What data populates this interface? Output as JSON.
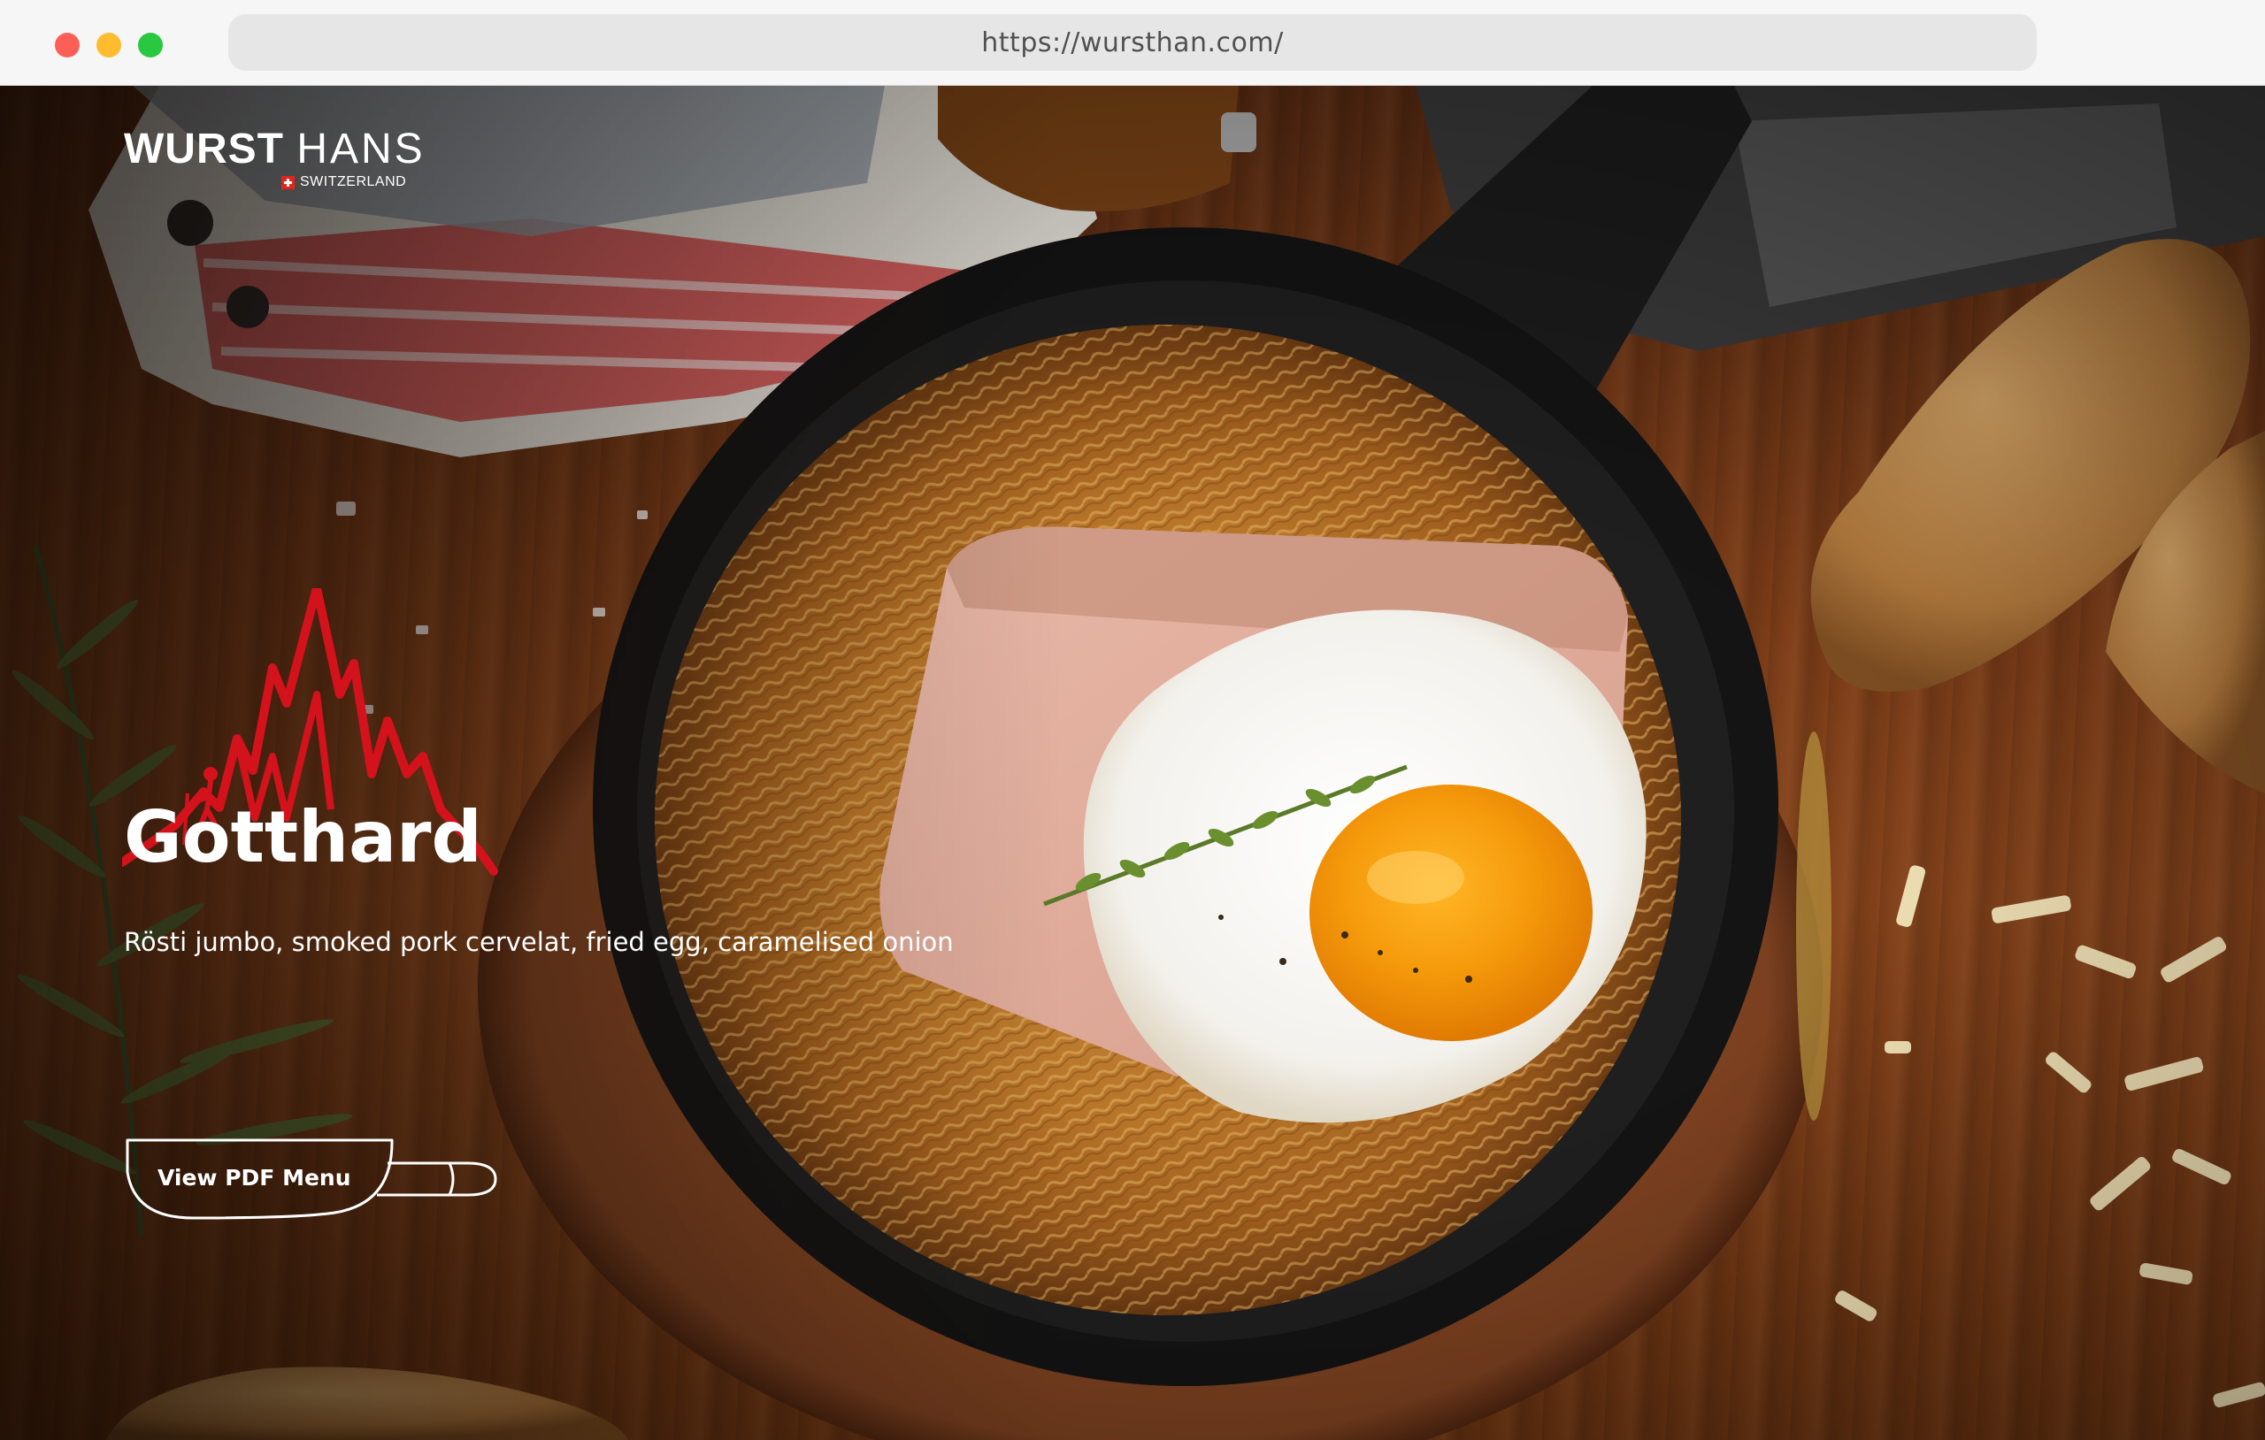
{
  "browser": {
    "url": "https://wursthan.com/",
    "buttons": [
      "close",
      "minimize",
      "maximize"
    ]
  },
  "brand": {
    "name_part1": "WURST",
    "name_part2": "HANS",
    "country": "SWITZERLAND",
    "accent_color": "#d3121c"
  },
  "hero": {
    "title": "Gotthard",
    "description": "Rösti jumbo, smoked pork cervelat, fried egg, caramelised onion",
    "cta_label": "View PDF Menu",
    "cta_icon": "sausage-outline-button"
  }
}
